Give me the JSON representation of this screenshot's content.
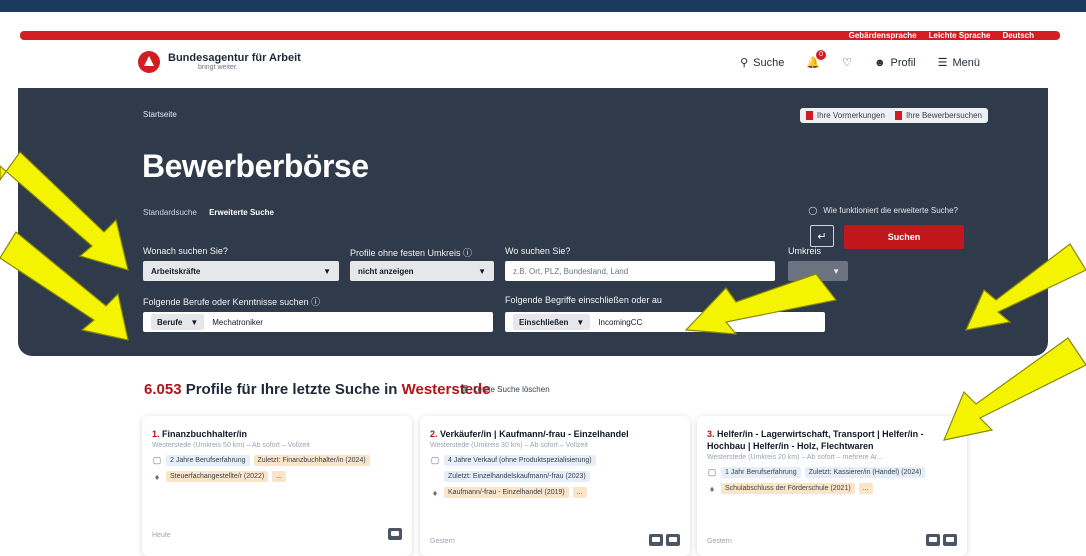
{
  "topbar": {
    "sign_language": "Gebärdensprache",
    "easy_language": "Leichte Sprache",
    "language": "Deutsch"
  },
  "header": {
    "brand_name": "Bundesagentur für Arbeit",
    "brand_claim": "bringt weiter.",
    "search_label": "Suche",
    "notification_count": "0",
    "profile_label": "Profil",
    "menu_label": "Menü"
  },
  "hero": {
    "breadcrumb": "Startseite",
    "saved_label": "Ihre Vormerkungen",
    "applicant_searches_label": "Ihre Bewerbersuchen",
    "title": "Bewerberbörse",
    "mode_standard": "Standardsuche",
    "mode_extended": "Erweiterte Suche",
    "howto_label": "Wie funktioniert die erweiterte Suche?"
  },
  "form": {
    "what_label": "Wonach suchen Sie?",
    "what_value": "Arbeitskräfte",
    "radius_profiles_label": "Profile ohne festen Umkreis ⓘ",
    "radius_profiles_value": "nicht anzeigen",
    "where_label": "Wo suchen Sie?",
    "where_placeholder": "z.B. Ort, PLZ, Bundesland, Land",
    "radius_label": "Umkreis",
    "skills_label": "Folgende Berufe oder Kenntnisse suchen ⓘ",
    "skills_type": "Berufe",
    "skills_value": "Mechatroniker",
    "terms_label": "Folgende Begriffe einschließen oder au",
    "terms_mode": "Einschließen",
    "terms_value": "IncomingCC",
    "enter_symbol": "↵",
    "search_button": "Suchen"
  },
  "results": {
    "count": "6.053",
    "text_middle": "Profile für Ihre letzte Suche in",
    "location": "Westerstede",
    "clear_label": "Letzte Suche löschen"
  },
  "cards": [
    {
      "index": "1.",
      "title": "Finanzbuchhalter/in",
      "subtitle": "Westerstede (Umkreis 50 km) – Ab sofort – Vollzeit",
      "chip_a": "2 Jahre Berufserfahrung",
      "chip_b": "Zuletzt: Finanzbuchhalter/in (2024)",
      "chip_c": "Steuerfachangestellte/r (2022)",
      "chip_more": "...",
      "date": "Heute"
    },
    {
      "index": "2.",
      "title": "Verkäufer/in  |  Kaufmann/-frau - Einzelhandel",
      "subtitle": "Westerstede (Umkreis 30 km) – Ab sofort – Vollzeit",
      "chip_a": "4 Jahre Verkauf (ohne Produktspezialisierung)",
      "chip_b": "Zuletzt: Einzelhandelskaufmann/-frau (2023)",
      "chip_c": "Kaufmann/-frau - Einzelhandel (2019)",
      "chip_more": "...",
      "date": "Gestern"
    },
    {
      "index": "3.",
      "title": "Helfer/in - Lagerwirtschaft, Transport  |  Helfer/in - Hochbau  |  Helfer/in - Holz, Flechtwaren",
      "subtitle": "Westerstede (Umkreis 20 km) – Ab sofort – mehrere Ar...",
      "chip_a": "1 Jahr Berufserfahrung",
      "chip_b": "Zuletzt: Kassierer/in (Handel) (2024)",
      "chip_c": "Schulabschluss der Förderschule (2021)",
      "chip_more": "...",
      "date": "Gestern"
    }
  ],
  "colors": {
    "brand_red": "#d21e23",
    "hero_bg": "#2f3a4a",
    "annotation_arrow": "#f4f400"
  }
}
